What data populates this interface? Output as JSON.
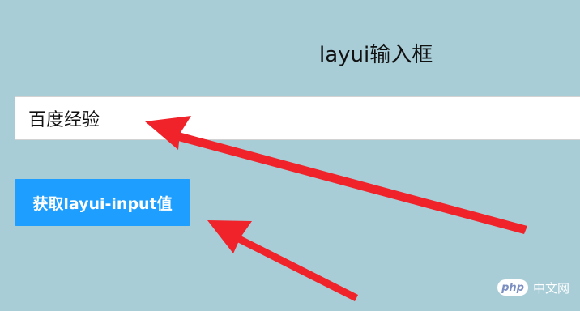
{
  "page": {
    "title": "layui输入框",
    "background_color": "#a8cdd7"
  },
  "input": {
    "value": "百度经验",
    "placeholder": ""
  },
  "button": {
    "label": "获取layui-input值",
    "color": "#1e9fff"
  },
  "annotation": {
    "arrow_color": "#f0222a"
  },
  "watermark": {
    "logo": "php",
    "site": "中文网"
  }
}
